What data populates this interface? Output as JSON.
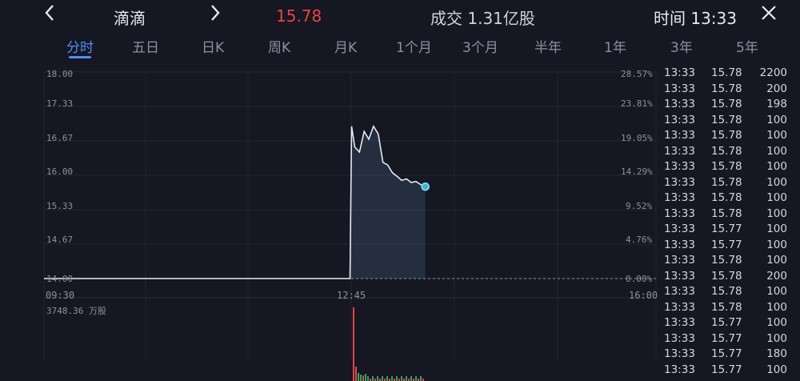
{
  "header": {
    "back_icon": "chevron-left-icon",
    "name": "滴滴",
    "next_icon": "chevron-right-icon",
    "price": "15.78",
    "volume": "成交 1.31亿股",
    "time": "时间 13:33",
    "close_icon": "close-icon",
    "price_color": "#e8443d"
  },
  "tabs": [
    {
      "label": "分时",
      "active": true
    },
    {
      "label": "五日"
    },
    {
      "label": "日K"
    },
    {
      "label": "周K"
    },
    {
      "label": "月K"
    },
    {
      "label": "1个月"
    },
    {
      "label": "3个月"
    },
    {
      "label": "半年"
    },
    {
      "label": "1年"
    },
    {
      "label": "3年"
    },
    {
      "label": "5年"
    }
  ],
  "chart": {
    "price_labels": [
      "18.00",
      "17.33",
      "16.67",
      "16.00",
      "15.33",
      "14.67",
      "14.00"
    ],
    "pct_labels": [
      "28.57%",
      "23.81%",
      "19.05%",
      "14.29%",
      "9.52%",
      "4.76%",
      "0.00%"
    ],
    "x_labels": [
      "09:30",
      "12:45",
      "16:00"
    ],
    "volume_label": "3748.36 万股"
  },
  "chart_data": {
    "type": "line",
    "x": [
      "09:30",
      "12:45",
      "12:46",
      "12:48",
      "12:51",
      "12:54",
      "12:57",
      "13:00",
      "13:03",
      "13:06",
      "13:09",
      "13:12",
      "13:15",
      "13:18",
      "13:21",
      "13:24",
      "13:27",
      "13:30",
      "13:33"
    ],
    "series": [
      {
        "values": [
          14.0,
          14.0,
          16.95,
          16.55,
          16.45,
          16.85,
          16.7,
          16.95,
          16.8,
          16.25,
          16.2,
          16.05,
          15.98,
          15.9,
          15.93,
          15.86,
          15.88,
          15.82,
          15.78
        ]
      }
    ],
    "ylim": [
      14.0,
      18.0
    ],
    "reference_price": 14.0
  },
  "ticks": [
    {
      "time": "13:33",
      "price": "15.78",
      "qty": "2200"
    },
    {
      "time": "13:33",
      "price": "15.78",
      "qty": "200"
    },
    {
      "time": "13:33",
      "price": "15.78",
      "qty": "198"
    },
    {
      "time": "13:33",
      "price": "15.78",
      "qty": "100"
    },
    {
      "time": "13:33",
      "price": "15.78",
      "qty": "100"
    },
    {
      "time": "13:33",
      "price": "15.78",
      "qty": "100"
    },
    {
      "time": "13:33",
      "price": "15.78",
      "qty": "100"
    },
    {
      "time": "13:33",
      "price": "15.78",
      "qty": "100"
    },
    {
      "time": "13:33",
      "price": "15.78",
      "qty": "100"
    },
    {
      "time": "13:33",
      "price": "15.78",
      "qty": "100"
    },
    {
      "time": "13:33",
      "price": "15.77",
      "qty": "100"
    },
    {
      "time": "13:33",
      "price": "15.77",
      "qty": "100"
    },
    {
      "time": "13:33",
      "price": "15.78",
      "qty": "100"
    },
    {
      "time": "13:33",
      "price": "15.78",
      "qty": "200"
    },
    {
      "time": "13:33",
      "price": "15.78",
      "qty": "100"
    },
    {
      "time": "13:33",
      "price": "15.78",
      "qty": "100"
    },
    {
      "time": "13:33",
      "price": "15.77",
      "qty": "100"
    },
    {
      "time": "13:33",
      "price": "15.77",
      "qty": "100"
    },
    {
      "time": "13:33",
      "price": "15.77",
      "qty": "180"
    },
    {
      "time": "13:33",
      "price": "15.77",
      "qty": "100"
    }
  ]
}
